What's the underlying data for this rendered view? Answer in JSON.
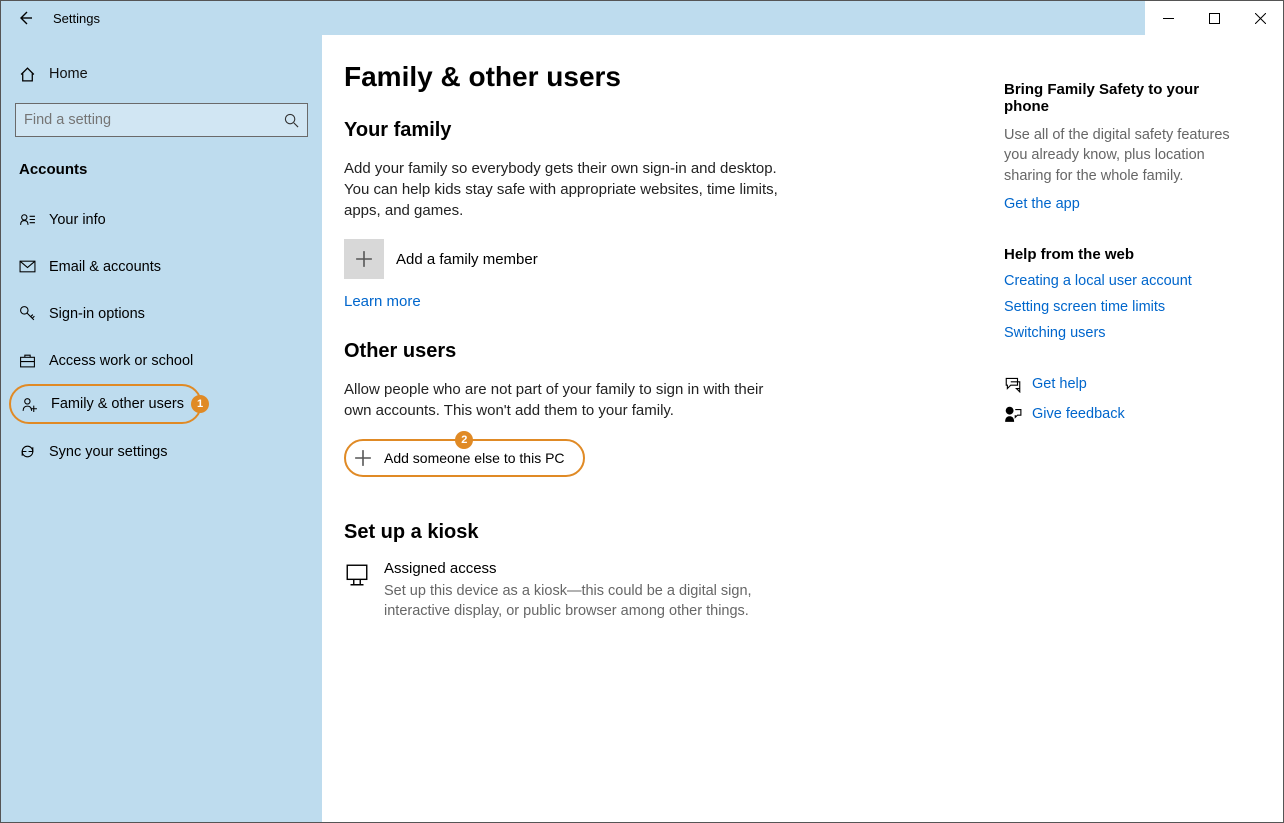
{
  "window": {
    "title": "Settings"
  },
  "sidebar": {
    "home": "Home",
    "search_placeholder": "Find a setting",
    "section": "Accounts",
    "items": [
      {
        "label": "Your info"
      },
      {
        "label": "Email & accounts"
      },
      {
        "label": "Sign-in options"
      },
      {
        "label": "Access work or school"
      },
      {
        "label": "Family & other users"
      },
      {
        "label": "Sync your settings"
      }
    ]
  },
  "annotations": {
    "badge1": "1",
    "badge2": "2"
  },
  "page": {
    "title": "Family & other users",
    "family": {
      "heading": "Your family",
      "desc": "Add your family so everybody gets their own sign-in and desktop. You can help kids stay safe with appropriate websites, time limits, apps, and games.",
      "add_label": "Add a family member",
      "learn_more": "Learn more"
    },
    "other": {
      "heading": "Other users",
      "desc": "Allow people who are not part of your family to sign in with their own accounts. This won't add them to your family.",
      "add_label": "Add someone else to this PC"
    },
    "kiosk": {
      "heading": "Set up a kiosk",
      "title": "Assigned access",
      "desc": "Set up this device as a kiosk—this could be a digital sign, interactive display, or public browser among other things."
    }
  },
  "aside": {
    "family_safety": {
      "heading": "Bring Family Safety to your phone",
      "desc": "Use all of the digital safety features you already know, plus location sharing for the whole family.",
      "link": "Get the app"
    },
    "help": {
      "heading": "Help from the web",
      "links": [
        "Creating a local user account",
        "Setting screen time limits",
        "Switching users"
      ]
    },
    "get_help": "Get help",
    "feedback": "Give feedback"
  }
}
